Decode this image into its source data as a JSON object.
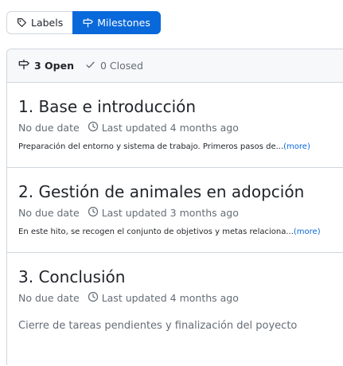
{
  "subnav": {
    "labels_label": "Labels",
    "milestones_label": "Milestones"
  },
  "header": {
    "open_label": "3 Open",
    "closed_label": "0 Closed"
  },
  "milestones": [
    {
      "title": "1. Base e introducción",
      "due": "No due date",
      "updated": "Last updated 4 months ago",
      "description": "Preparación del entorno y sistema de trabajo. Primeros pasos de...",
      "more": "(more)"
    },
    {
      "title": "2. Gestión de animales en adopción",
      "due": "No due date",
      "updated": "Last updated 3 months ago",
      "description": "En este hito, se recogen el conjunto de objetivos y metas relaciona...",
      "more": "(more)"
    },
    {
      "title": "3. Conclusión",
      "due": "No due date",
      "updated": "Last updated 4 months ago",
      "description": "Cierre de tareas pendientes y finalización del poyecto"
    }
  ],
  "colors": {
    "accent": "#0969da",
    "border": "#d0d7de",
    "muted": "#656d76"
  },
  "icons": [
    "tag-icon",
    "milestone-icon",
    "check-icon",
    "clock-icon"
  ]
}
